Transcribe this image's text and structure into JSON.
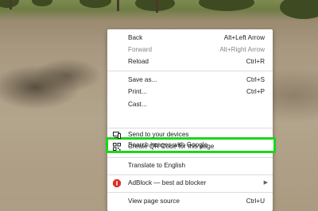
{
  "context_menu": {
    "items": {
      "back": {
        "label": "Back",
        "shortcut": "Alt+Left Arrow"
      },
      "forward": {
        "label": "Forward",
        "shortcut": "Alt+Right Arrow"
      },
      "reload": {
        "label": "Reload",
        "shortcut": "Ctrl+R"
      },
      "save_as": {
        "label": "Save as...",
        "shortcut": "Ctrl+S"
      },
      "print": {
        "label": "Print...",
        "shortcut": "Ctrl+P"
      },
      "cast": {
        "label": "Cast..."
      },
      "search_images": {
        "label": "Search images with Google"
      },
      "send_devices": {
        "label": "Send to your devices",
        "icon": "devices-icon"
      },
      "qr_code": {
        "label": "Create QR Code for this page",
        "icon": "qr-code-icon"
      },
      "translate": {
        "label": "Translate to English"
      },
      "adblock": {
        "label": "AdBlock — best ad blocker",
        "icon": "adblock-icon"
      },
      "view_source": {
        "label": "View page source",
        "shortcut": "Ctrl+U"
      }
    },
    "highlight_color": "#19d619"
  }
}
